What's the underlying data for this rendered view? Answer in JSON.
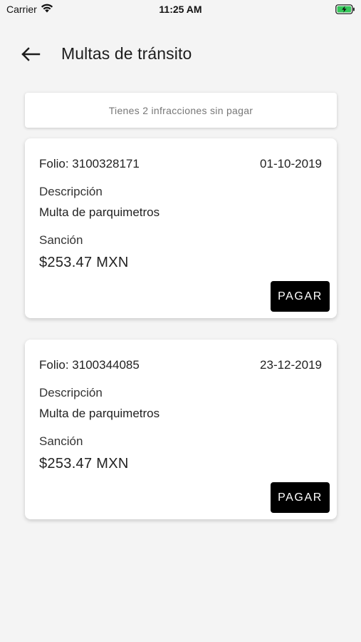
{
  "status_bar": {
    "carrier": "Carrier",
    "time": "11:25 AM",
    "battery_color": "#34c759"
  },
  "header": {
    "back_icon": "arrow-left-icon",
    "title": "Multas de tránsito"
  },
  "summary": {
    "text": "Tienes 2 infracciones sin pagar"
  },
  "fines": [
    {
      "folio": "Folio: 3100328171",
      "date": "01-10-2019",
      "description_label": "Descripción",
      "description": "Multa de parquimetros",
      "sanction_label": "Sanción",
      "amount": "$253.47 MXN",
      "pay_label": "PAGAR"
    },
    {
      "folio": "Folio: 3100344085",
      "date": "23-12-2019",
      "description_label": "Descripción",
      "description": "Multa de parquimetros",
      "sanction_label": "Sanción",
      "amount": "$253.47 MXN",
      "pay_label": "PAGAR"
    }
  ]
}
